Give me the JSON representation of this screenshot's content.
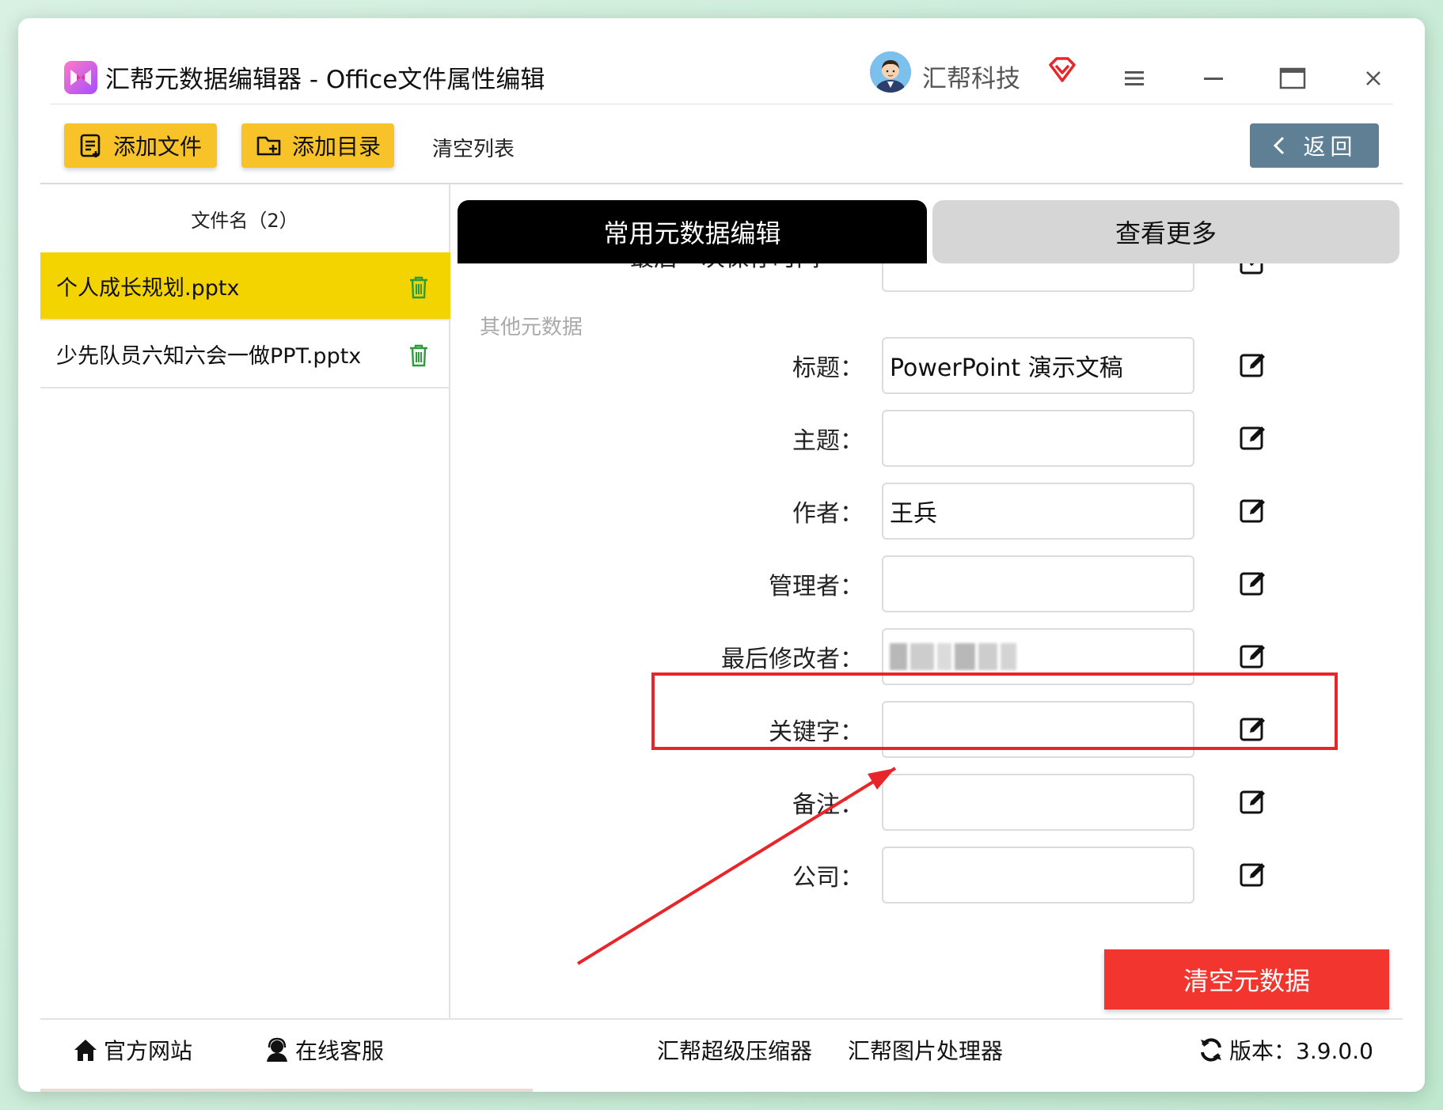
{
  "window": {
    "title": "汇帮元数据编辑器 - Office文件属性编辑",
    "username": "汇帮科技"
  },
  "toolbar": {
    "add_file": "添加文件",
    "add_directory": "添加目录",
    "clear_list": "清空列表",
    "back": "返回"
  },
  "file_list": {
    "header": "文件名（2）",
    "items": [
      {
        "name": "个人成长规划.pptx",
        "selected": true
      },
      {
        "name": "少先队员六知六会一做PPT.pptx",
        "selected": false
      }
    ]
  },
  "tabs": {
    "active": "常用元数据编辑",
    "inactive": "查看更多"
  },
  "metadata": {
    "partial_label": "最后一次保存时间",
    "section_label": "其他元数据",
    "fields": [
      {
        "label": "标题：",
        "value": "PowerPoint 演示文稿"
      },
      {
        "label": "主题：",
        "value": ""
      },
      {
        "label": "作者：",
        "value": "王兵"
      },
      {
        "label": "管理者：",
        "value": ""
      },
      {
        "label": "最后修改者：",
        "value": ""
      },
      {
        "label": "关键字：",
        "value": ""
      },
      {
        "label": "备注：",
        "value": ""
      },
      {
        "label": "公司：",
        "value": ""
      }
    ],
    "highlighted_field": "最后修改者："
  },
  "actions": {
    "clear_metadata": "清空元数据"
  },
  "footer": {
    "website": "官方网站",
    "support": "在线客服",
    "compressor": "汇帮超级压缩器",
    "image_processor": "汇帮图片处理器",
    "version": "版本：3.9.0.0"
  },
  "colors": {
    "accent_yellow": "#f8c229",
    "selected_row": "#f3d300",
    "back_button": "#5f7f94",
    "danger": "#f2362f",
    "highlight": "#e8262a"
  }
}
